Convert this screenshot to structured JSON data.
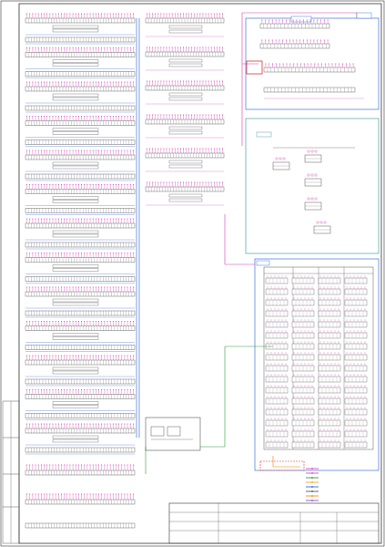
{
  "title_block": {
    "organization": "",
    "drawing_title": "",
    "sheet_name": "",
    "drawing_code": "",
    "stage": "",
    "sheet": "",
    "sheets_total": ""
  },
  "legend": {
    "heading": "",
    "items": [
      {
        "label": "",
        "color": "#d53ab2"
      },
      {
        "label": "",
        "color": "#d53ab2"
      },
      {
        "label": "",
        "color": "#2e7d32"
      },
      {
        "label": "",
        "color": "#ff9800"
      },
      {
        "label": "",
        "color": "#1e5bd6"
      },
      {
        "label": "",
        "color": "#444444"
      },
      {
        "label": "",
        "color": "#ff7a00"
      },
      {
        "label": "",
        "color": "#7b3fb3"
      }
    ]
  },
  "side_stamp": {
    "text": ""
  },
  "colors": {
    "frame": "#333333",
    "magenta_cable": "#d53ab2",
    "blue_cable": "#1e5bd6",
    "teal_box": "#2f8f94",
    "green_line": "#2e9c3a",
    "orange_line": "#ff7a00",
    "red_box": "#e0352b"
  }
}
